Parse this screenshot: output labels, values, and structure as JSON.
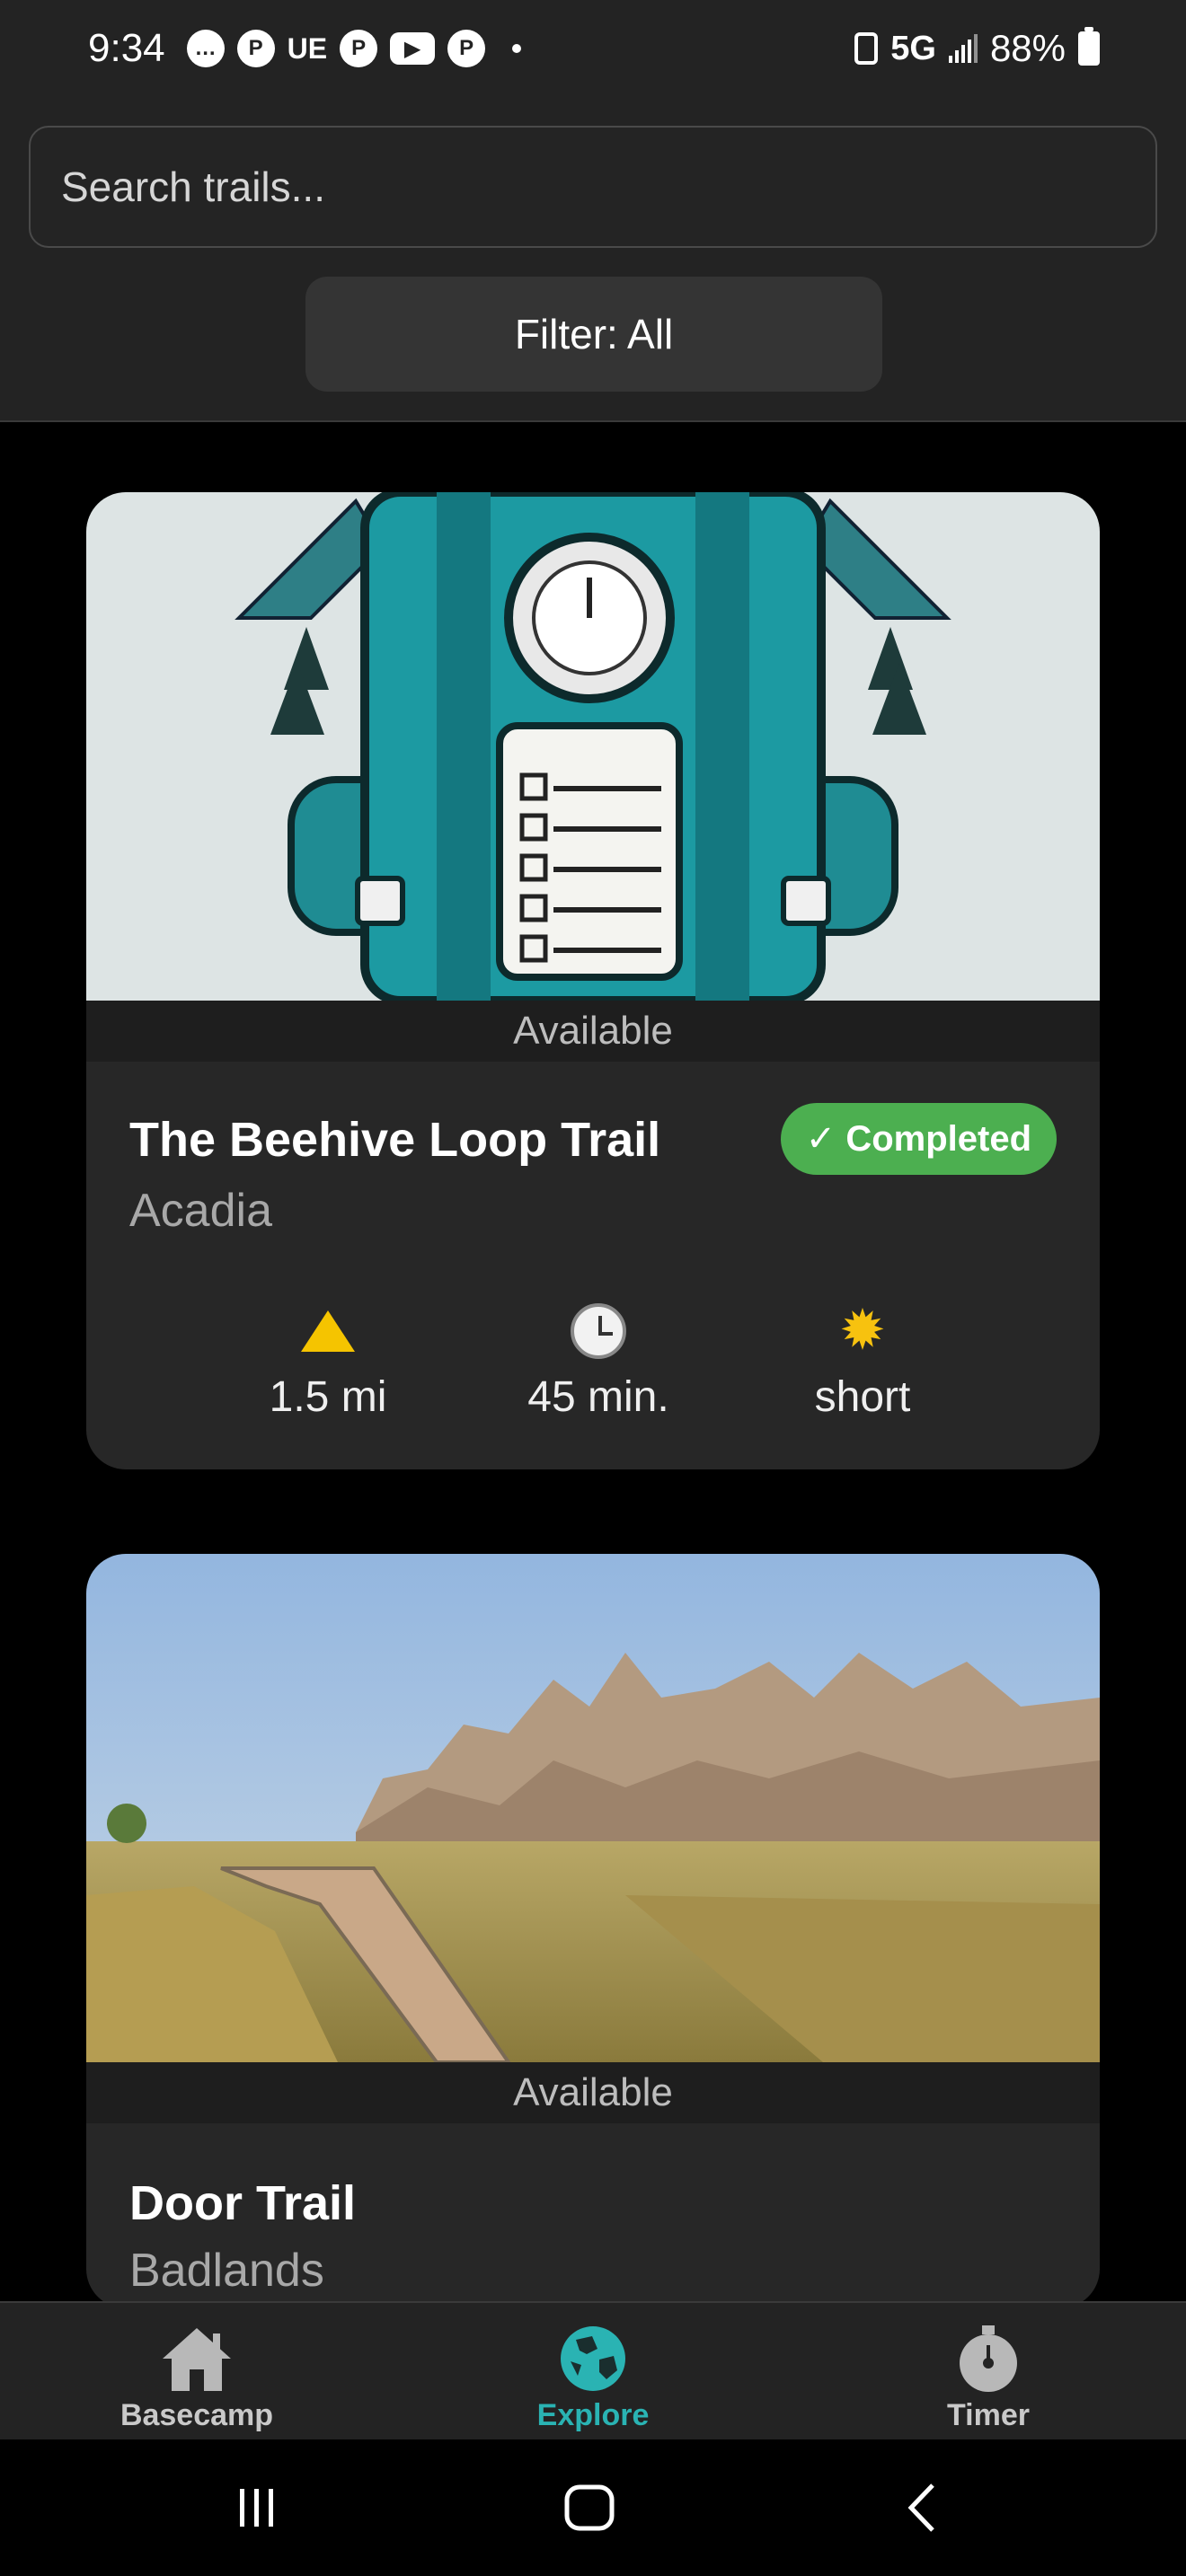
{
  "status_bar": {
    "time": "9:34",
    "notifications": [
      "chat-icon",
      "pinterest-icon",
      "ue-icon",
      "pinterest-icon",
      "youtube-icon",
      "pinterest-icon"
    ],
    "ue_label": "UE",
    "network": "5G",
    "battery": "88%"
  },
  "search": {
    "placeholder": "Search trails..."
  },
  "filter": {
    "label": "Filter: All"
  },
  "trails": [
    {
      "availability": "Available",
      "name": "The Beehive Loop Trail",
      "park": "Acadia",
      "badge": "✓ Completed",
      "stats": {
        "distance": "1.5 mi",
        "time": "45 min.",
        "length": "short"
      }
    },
    {
      "availability": "Available",
      "name": "Door Trail",
      "park": "Badlands"
    }
  ],
  "bottom_nav": {
    "items": [
      {
        "label": "Basecamp",
        "icon": "house-icon"
      },
      {
        "label": "Explore",
        "icon": "globe-icon",
        "active": true
      },
      {
        "label": "Timer",
        "icon": "stopwatch-icon"
      }
    ]
  },
  "colors": {
    "accent": "#2ab3b3",
    "completed": "#4caf50",
    "background": "#000000",
    "card": "#272727"
  }
}
